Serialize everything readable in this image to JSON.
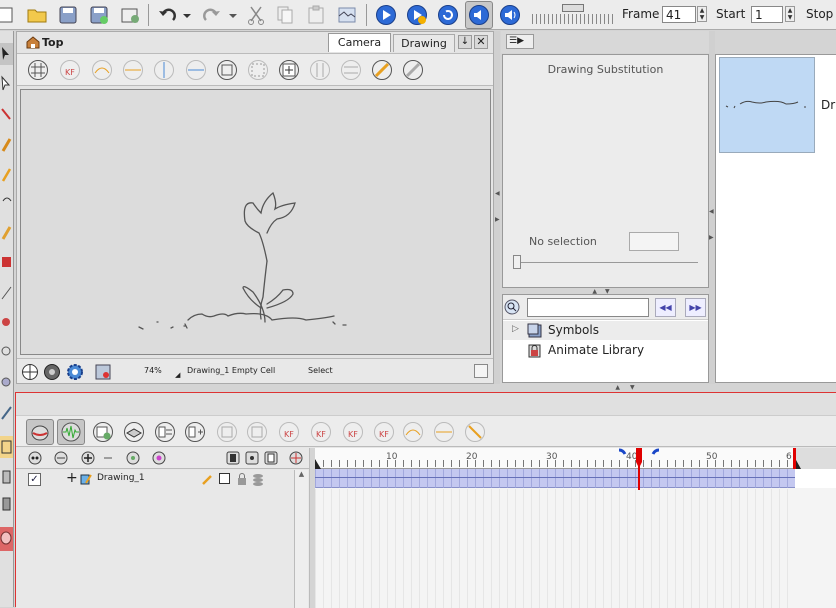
{
  "toolbar": {
    "frame_label": "Frame",
    "frame_value": "41",
    "start_label": "Start",
    "start_value": "1",
    "stop_label": "Stop"
  },
  "camera_view": {
    "title": "Top",
    "tabs": [
      "Camera",
      "Drawing"
    ],
    "active_tab": "Camera",
    "zoom": "74%",
    "status_drawing": "Drawing_1 Empty Cell",
    "status_tool": "Select"
  },
  "drawing_substitution": {
    "title": "Drawing Substitution",
    "selection": "No selection"
  },
  "thumbnail_panel": {
    "label": "Dr"
  },
  "library": {
    "search_placeholder": "",
    "items": [
      "Symbols",
      "Animate Library"
    ]
  },
  "timeline": {
    "current_frame": 41,
    "stop_frame": 60,
    "tick_labels": [
      "10",
      "20",
      "30",
      "40",
      "50",
      "6"
    ],
    "layers": [
      {
        "name": "Drawing_1",
        "checked": true
      }
    ]
  },
  "colors": {
    "accent_blue": "#1a47c8",
    "playhead_red": "#e00000",
    "selected_cells": "#c4c8f0",
    "thumb_bg": "#bfd9f4",
    "red_border": "#d33"
  }
}
